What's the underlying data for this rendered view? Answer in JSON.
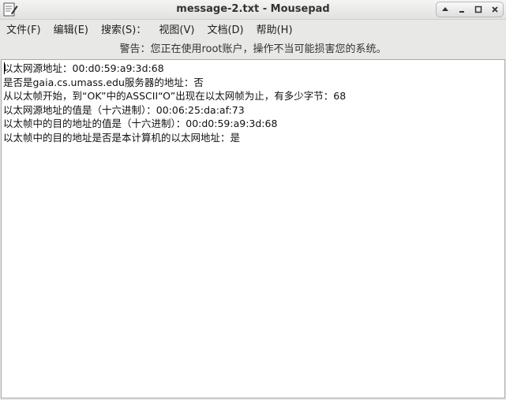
{
  "window": {
    "title": "message-2.txt - Mousepad",
    "app_icon": "text-editor-icon",
    "buttons": [
      "arrow-up-icon",
      "minimize-icon",
      "maximize-icon",
      "close-icon"
    ]
  },
  "menu": {
    "file": "文件(F)",
    "edit": "编辑(E)",
    "search": "搜索(S)：",
    "view": "视图(V)",
    "document": "文档(D)",
    "help": "帮助(H)"
  },
  "warning": "警告：您正在使用root账户，操作不当可能损害您的系统。",
  "editor": {
    "lines": [
      "以太网源地址：00:d0:59:a9:3d:68",
      "是否是gaia.cs.umass.edu服务器的地址：否",
      "从以太帧开始，到“OK”中的ASSCII“O”出现在以太网帧为止，有多少字节：68",
      "以太网源地址的值是（十六进制）：00:06:25:da:af:73",
      "以太帧中的目的地址的值是（十六进制）：00:d0:59:a9:3d:68",
      "以太帧中的目的地址是否是本计算机的以太网地址：是"
    ]
  }
}
